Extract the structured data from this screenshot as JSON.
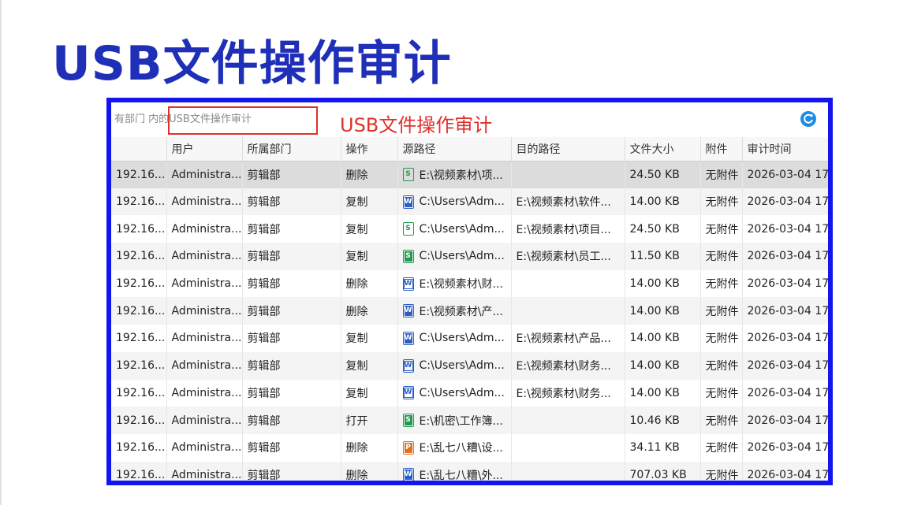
{
  "title": "USB文件操作审计",
  "toolbar": {
    "search_text": "有部门 内的USB文件操作审计",
    "annotation": "USB文件操作审计"
  },
  "columns": [
    "",
    "用户",
    "所属部门",
    "操作",
    "源路径",
    "目的路径",
    "文件大小",
    "附件",
    "审计时间"
  ],
  "rows": [
    {
      "ip": "192.16...",
      "user": "Administra...",
      "dept": "剪辑部",
      "op": "删除",
      "icon": "xls",
      "src": "E:\\视频素材\\项...",
      "dst": "",
      "size": "24.50 KB",
      "att": "无附件",
      "time": "2026-03-04 17:",
      "selected": true
    },
    {
      "ip": "192.16...",
      "user": "Administra...",
      "dept": "剪辑部",
      "op": "复制",
      "icon": "doc",
      "src": "C:\\Users\\Adm...",
      "dst": "E:\\视频素材\\软件...",
      "size": "14.00 KB",
      "att": "无附件",
      "time": "2026-03-04 17:"
    },
    {
      "ip": "192.16...",
      "user": "Administra...",
      "dept": "剪辑部",
      "op": "复制",
      "icon": "xls",
      "src": "C:\\Users\\Adm...",
      "dst": "E:\\视频素材\\项目...",
      "size": "24.50 KB",
      "att": "无附件",
      "time": "2026-03-04 17:"
    },
    {
      "ip": "192.16...",
      "user": "Administra...",
      "dept": "剪辑部",
      "op": "复制",
      "icon": "xls-solid",
      "src": "C:\\Users\\Adm...",
      "dst": "E:\\视频素材\\员工...",
      "size": "11.50 KB",
      "att": "无附件",
      "time": "2026-03-04 17:"
    },
    {
      "ip": "192.16...",
      "user": "Administra...",
      "dept": "剪辑部",
      "op": "删除",
      "icon": "doc-outline",
      "src": "E:\\视频素材\\财...",
      "dst": "",
      "size": "14.00 KB",
      "att": "无附件",
      "time": "2026-03-04 17:"
    },
    {
      "ip": "192.16...",
      "user": "Administra...",
      "dept": "剪辑部",
      "op": "删除",
      "icon": "doc",
      "src": "E:\\视频素材\\产...",
      "dst": "",
      "size": "14.00 KB",
      "att": "无附件",
      "time": "2026-03-04 17:"
    },
    {
      "ip": "192.16...",
      "user": "Administra...",
      "dept": "剪辑部",
      "op": "复制",
      "icon": "doc",
      "src": "C:\\Users\\Adm...",
      "dst": "E:\\视频素材\\产品...",
      "size": "14.00 KB",
      "att": "无附件",
      "time": "2026-03-04 17:"
    },
    {
      "ip": "192.16...",
      "user": "Administra...",
      "dept": "剪辑部",
      "op": "复制",
      "icon": "doc-outline",
      "src": "C:\\Users\\Adm...",
      "dst": "E:\\视频素材\\财务...",
      "size": "14.00 KB",
      "att": "无附件",
      "time": "2026-03-04 17:"
    },
    {
      "ip": "192.16...",
      "user": "Administra...",
      "dept": "剪辑部",
      "op": "复制",
      "icon": "doc-outline",
      "src": "C:\\Users\\Adm...",
      "dst": "E:\\视频素材\\财务...",
      "size": "14.00 KB",
      "att": "无附件",
      "time": "2026-03-04 17:"
    },
    {
      "ip": "192.16...",
      "user": "Administra...",
      "dept": "剪辑部",
      "op": "打开",
      "icon": "xls-solid",
      "src": "E:\\机密\\工作簿...",
      "dst": "",
      "size": "10.46 KB",
      "att": "无附件",
      "time": "2026-03-04 17:"
    },
    {
      "ip": "192.16...",
      "user": "Administra...",
      "dept": "剪辑部",
      "op": "删除",
      "icon": "ppt",
      "src": "E:\\乱七八糟\\设...",
      "dst": "",
      "size": "34.11 KB",
      "att": "无附件",
      "time": "2026-03-04 17:"
    },
    {
      "ip": "192.16...",
      "user": "Administra...",
      "dept": "剪辑部",
      "op": "删除",
      "icon": "doc",
      "src": "E:\\乱七八糟\\外...",
      "dst": "",
      "size": "707.03 KB",
      "att": "无附件",
      "time": "2026-03-04 17:"
    }
  ],
  "colors": {
    "accent": "#1414ee",
    "title": "#1f2fb8",
    "annotation": "#e0302a",
    "refresh": "#1e8be6"
  }
}
